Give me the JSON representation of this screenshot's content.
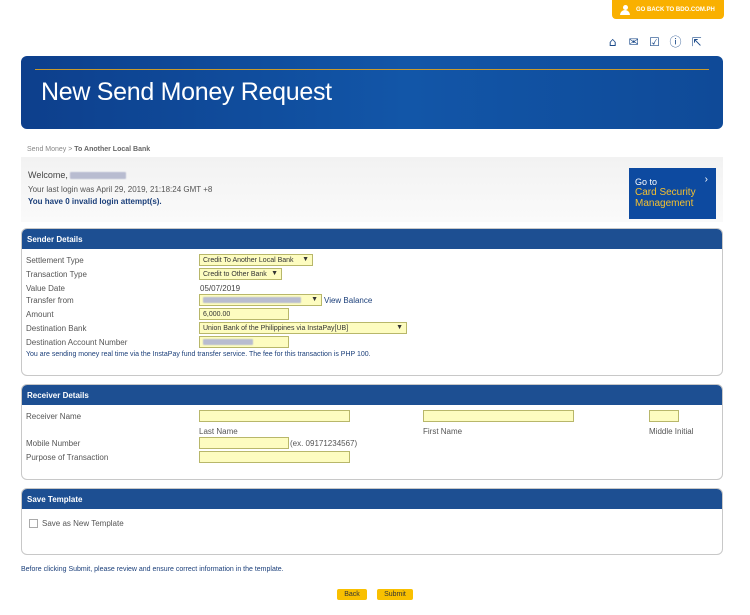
{
  "top": {
    "go_back": "GO BACK TO BDO.COM.PH"
  },
  "icons": [
    "home-icon",
    "mail-icon",
    "checklist-icon",
    "info-icon",
    "share-icon"
  ],
  "banner": {
    "title": "New Send Money Request"
  },
  "breadcrumb": {
    "parent": "Send Money",
    "sep": " > ",
    "current": "To Another Local Bank"
  },
  "welcome": {
    "greeting": "Welcome,",
    "last_login": "Your last login was April 29, 2019, 21:18:24 GMT +8",
    "invalid": "You have 0 invalid login attempt(s)."
  },
  "card_security": {
    "line1": "Go to",
    "line2": "Card Security",
    "line3": "Management",
    "arrow": "›"
  },
  "sender": {
    "header": "Sender Details",
    "settlement_label": "Settlement Type",
    "settlement_value": "Credit To Another Local Bank",
    "transaction_label": "Transaction Type",
    "transaction_value": "Credit to Other Bank",
    "value_date_label": "Value Date",
    "value_date": "05/07/2019",
    "transfer_label": "Transfer from",
    "view_balance": "View Balance",
    "amount_label": "Amount",
    "amount_value": "6,000.00",
    "dest_bank_label": "Destination Bank",
    "dest_bank_value": "Union Bank of the Philippines via InstaPay[UB]",
    "dest_acct_label": "Destination Account Number",
    "note": "You are sending money real time via the InstaPay fund transfer service. The fee for this transaction is PHP 100."
  },
  "receiver": {
    "header": "Receiver Details",
    "name_label": "Receiver Name",
    "last_name": "Last Name",
    "first_name": "First Name",
    "middle_initial": "Middle Initial",
    "mobile_label": "Mobile Number",
    "mobile_hint": "(ex. 09171234567)",
    "purpose_label": "Purpose of Transaction"
  },
  "template": {
    "header": "Save Template",
    "save_label": "Save as New Template"
  },
  "footer_note": "Before clicking Submit, please review and ensure correct information in the template.",
  "buttons": {
    "back": "Back",
    "submit": "Submit"
  },
  "colors": {
    "brand_blue": "#1d4f92",
    "accent_yellow": "#f9b000",
    "field_yellow": "#fdfcc0"
  }
}
